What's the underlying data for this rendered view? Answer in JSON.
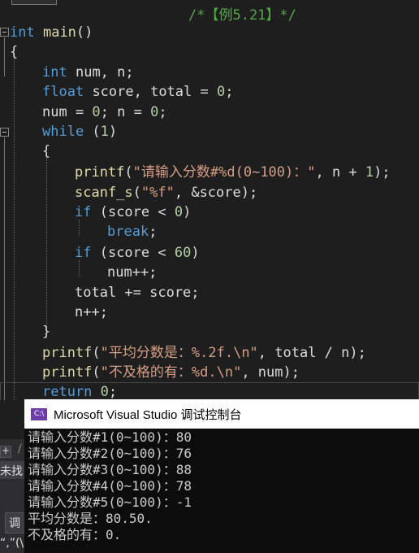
{
  "editor": {
    "top_comment": "/*【例5.21】*/",
    "code": {
      "l1_type": "int",
      "l1_fn": "main",
      "l1_rest": "()",
      "l2": "{",
      "l3_type": "int",
      "l3_vars": "num, n;",
      "l4_type": "float",
      "l4_rest": "score, total = ",
      "l4_num": "0",
      "l4_end": ";",
      "l5_a": "num = ",
      "l5_n1": "0",
      "l5_b": "; n = ",
      "l5_n2": "0",
      "l5_c": ";",
      "l6_kw": "while",
      "l6_a": " (",
      "l6_n": "1",
      "l6_b": ")",
      "l7": "{",
      "l8_fn": "printf",
      "l8_a": "(",
      "l8_str": "\"请输入分数#%d(0~100)：\"",
      "l8_b": ", n + ",
      "l8_n": "1",
      "l8_c": ");",
      "l9_fn": "scanf_s",
      "l9_a": "(",
      "l9_str": "\"%f\"",
      "l9_b": ", &score);",
      "l10_kw": "if",
      "l10_a": " (score < ",
      "l10_n": "0",
      "l10_b": ")",
      "l11_kw": "break",
      "l11_b": ";",
      "l12_kw": "if",
      "l12_a": " (score < ",
      "l12_n": "60",
      "l12_b": ")",
      "l13": "num++;",
      "l14": "total += score;",
      "l15": "n++;",
      "l16": "}",
      "l17_fn": "printf",
      "l17_a": "(",
      "l17_str": "\"平均分数是：%.2f.\\n\"",
      "l17_b": ", total / n);",
      "l18_fn": "printf",
      "l18_a": "(",
      "l18_str": "\"不及格的有：%d.\\n\"",
      "l18_b": ", num);",
      "l19_kw": "return",
      "l19_a": " ",
      "l19_n": "0",
      "l19_b": ";",
      "l20": "}"
    }
  },
  "console": {
    "icon_text": "C:\\",
    "title": "Microsoft Visual Studio 调试控制台",
    "lines": [
      "请输入分数#1(0~100)：80",
      "请输入分数#2(0~100)：76",
      "请输入分数#3(0~100)：88",
      "请输入分数#4(0~100)：78",
      "请输入分数#5(0~100)：-1",
      "平均分数是：80.50.",
      "不及格的有：0."
    ]
  },
  "side_panel": {
    "plus": "+",
    "slash": "/",
    "text_a": "未找",
    "text_b": "调",
    "text_c": "“,”(\\"
  }
}
